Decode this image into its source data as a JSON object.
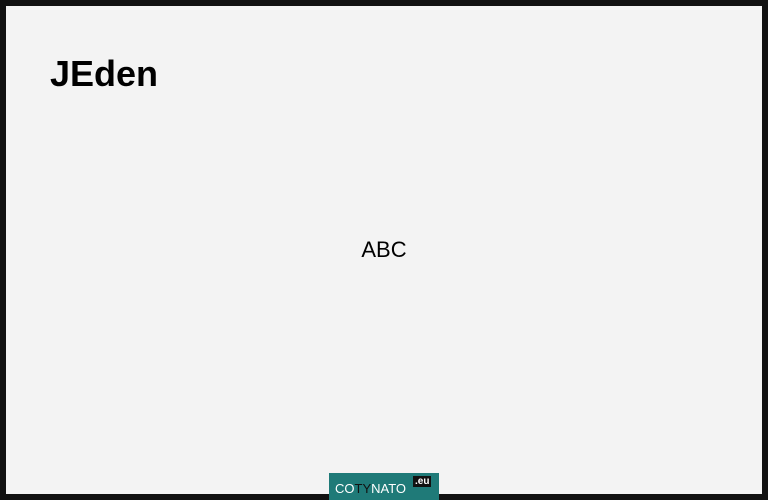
{
  "page": {
    "title": "JEden",
    "center_text": "ABC"
  },
  "logo": {
    "part1": "CO",
    "part2": "TY",
    "part3": "NATO",
    "tld": ".eu",
    "badge_color": "#1f7a78"
  },
  "colors": {
    "background": "#f3f3f3",
    "frame": "#111111",
    "text": "#000000"
  }
}
